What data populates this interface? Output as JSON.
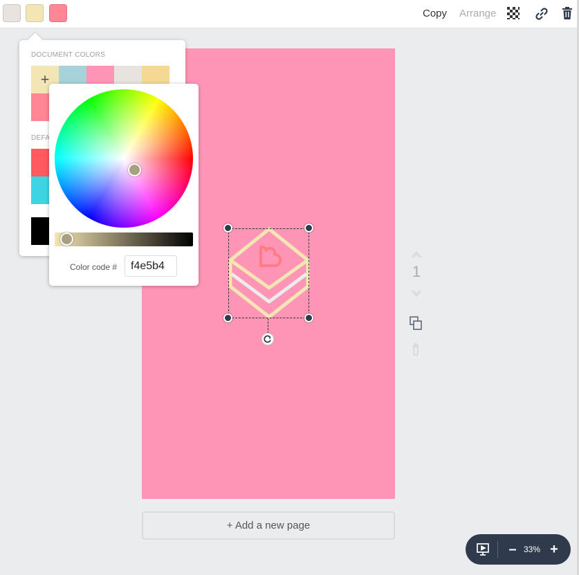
{
  "toolbar": {
    "swatches": [
      "#e8e3df",
      "#f4e5b4",
      "#ff8692"
    ],
    "copy_label": "Copy",
    "arrange_label": "Arrange",
    "icons": [
      "transparency-icon",
      "link-icon",
      "trash-icon"
    ]
  },
  "document_colors": {
    "heading": "DOCUMENT COLORS",
    "add_label": "+",
    "colors": [
      "#f4e5b4",
      "#a5d3d9",
      "#ff95b6",
      "#e8e3df",
      "#f4d894",
      "#ff8692"
    ]
  },
  "default_colors": {
    "heading": "DEFA",
    "colors": [
      "#ff5a5f",
      "#3dd5e4",
      "#000000"
    ]
  },
  "color_picker": {
    "code_label": "Color code #",
    "code_value": "f4e5b4"
  },
  "canvas": {
    "page_color": "#ff95b6",
    "add_page_label": "+ Add a new page",
    "page_number": "1"
  },
  "zoom": {
    "value": "33%",
    "minus_label": "–",
    "plus_label": "+"
  }
}
